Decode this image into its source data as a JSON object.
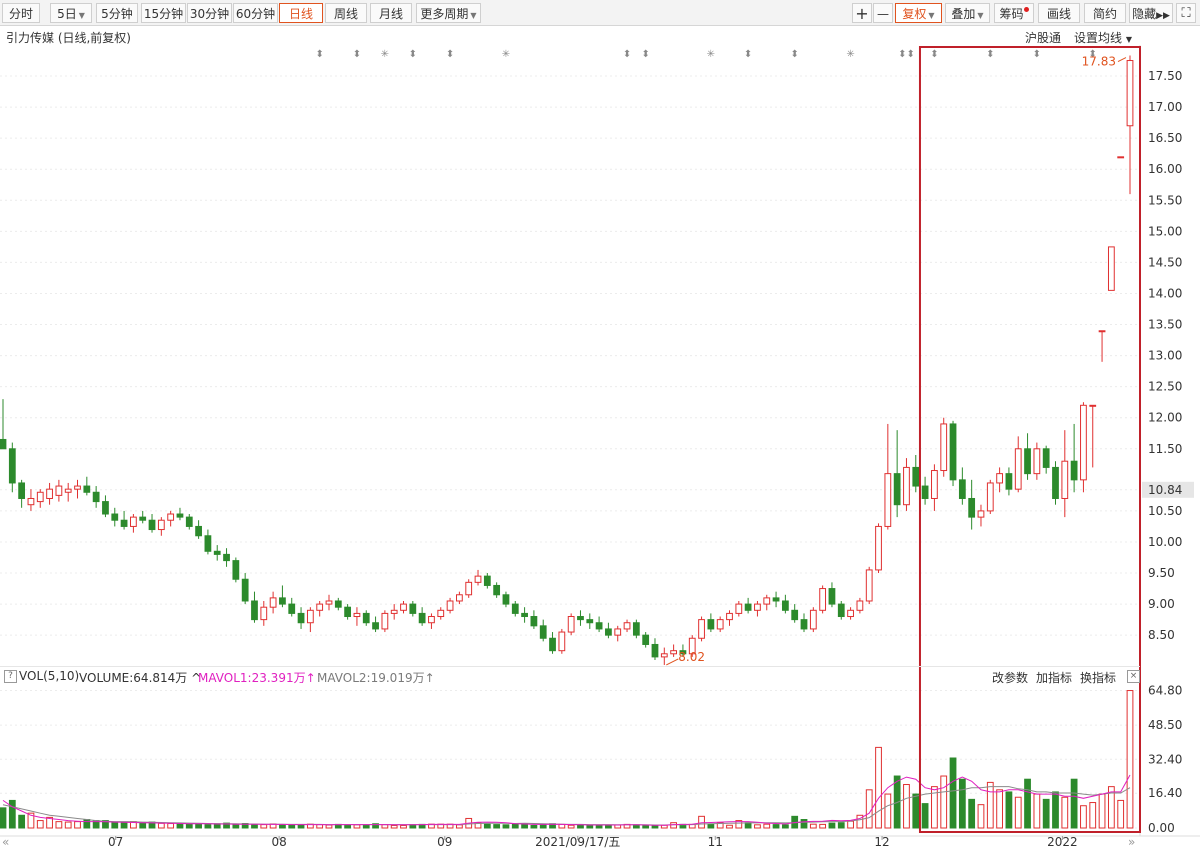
{
  "toolbar": {
    "left_buttons": [
      "分时",
      "5日",
      "5分钟",
      "15分钟",
      "30分钟",
      "60分钟",
      "日线",
      "周线",
      "月线",
      "更多周期"
    ],
    "active": "日线",
    "right_buttons": [
      "复权",
      "叠加",
      "筹码",
      "画线",
      "简约",
      "隐藏"
    ],
    "plus": "+",
    "minus": "—"
  },
  "chart_title": "引力传媒 (日线,前复权)",
  "links": {
    "hgt": "沪股通",
    "ma_settings": "设置均线"
  },
  "colors": {
    "up": "#e03030",
    "down": "#2c8a2c",
    "highlight": "#c0202a",
    "mavol1": "#e020c0",
    "mavol2": "#8a8a8a",
    "accent": "#e0531f"
  },
  "volume_header": {
    "name": "VOL(5,10)",
    "volume": "VOLUME:64.814万 ^",
    "mavol1": "MAVOL1:23.391万↑",
    "mavol2": "MAVOL2:19.019万↑",
    "actions": [
      "改参数",
      "加指标",
      "换指标"
    ],
    "help": "?",
    "close": "×"
  },
  "chart_data": [
    {
      "type": "candlestick",
      "title": "引力传媒 (日线,前复权)",
      "y_ticks": [
        8.5,
        9.0,
        9.5,
        10.0,
        10.5,
        10.84,
        11.5,
        12.0,
        12.5,
        13.0,
        13.5,
        14.0,
        14.5,
        15.0,
        15.5,
        16.0,
        16.5,
        17.0,
        17.5
      ],
      "current_price": 10.84,
      "ylim": [
        8.1,
        18.0
      ],
      "annotations": [
        {
          "label": "17.83",
          "kind": "high",
          "value": 17.83
        },
        {
          "label": "8.02",
          "kind": "low",
          "value": 8.02
        }
      ],
      "x_labels": [
        "07",
        "08",
        "09",
        "2021/09/17/五",
        "11",
        "12",
        "2022"
      ],
      "ohlc": [
        [
          11.65,
          12.3,
          11.55,
          11.5
        ],
        [
          11.5,
          11.6,
          10.8,
          10.95
        ],
        [
          10.95,
          11.0,
          10.55,
          10.7
        ],
        [
          10.6,
          10.85,
          10.5,
          10.7
        ],
        [
          10.65,
          10.85,
          10.55,
          10.8
        ],
        [
          10.7,
          10.95,
          10.6,
          10.85
        ],
        [
          10.75,
          11.0,
          10.65,
          10.9
        ],
        [
          10.8,
          10.95,
          10.65,
          10.85
        ],
        [
          10.85,
          11.0,
          10.7,
          10.9
        ],
        [
          10.9,
          11.05,
          10.75,
          10.8
        ],
        [
          10.8,
          10.9,
          10.55,
          10.65
        ],
        [
          10.65,
          10.75,
          10.4,
          10.45
        ],
        [
          10.45,
          10.55,
          10.25,
          10.35
        ],
        [
          10.35,
          10.5,
          10.2,
          10.25
        ],
        [
          10.25,
          10.45,
          10.15,
          10.4
        ],
        [
          10.4,
          10.5,
          10.3,
          10.35
        ],
        [
          10.35,
          10.45,
          10.15,
          10.2
        ],
        [
          10.2,
          10.4,
          10.1,
          10.35
        ],
        [
          10.35,
          10.5,
          10.25,
          10.45
        ],
        [
          10.45,
          10.55,
          10.35,
          10.4
        ],
        [
          10.4,
          10.45,
          10.2,
          10.25
        ],
        [
          10.25,
          10.35,
          10.05,
          10.1
        ],
        [
          10.1,
          10.2,
          9.8,
          9.85
        ],
        [
          9.85,
          9.95,
          9.7,
          9.8
        ],
        [
          9.8,
          9.9,
          9.6,
          9.7
        ],
        [
          9.7,
          9.75,
          9.35,
          9.4
        ],
        [
          9.4,
          9.5,
          9.0,
          9.05
        ],
        [
          9.05,
          9.2,
          8.7,
          8.75
        ],
        [
          8.75,
          9.05,
          8.65,
          8.95
        ],
        [
          8.95,
          9.2,
          8.85,
          9.1
        ],
        [
          9.1,
          9.3,
          8.95,
          9.0
        ],
        [
          9.0,
          9.1,
          8.8,
          8.85
        ],
        [
          8.85,
          8.95,
          8.6,
          8.7
        ],
        [
          8.7,
          8.95,
          8.55,
          8.9
        ],
        [
          8.9,
          9.05,
          8.8,
          9.0
        ],
        [
          9.0,
          9.15,
          8.9,
          9.05
        ],
        [
          9.05,
          9.1,
          8.9,
          8.95
        ],
        [
          8.95,
          9.0,
          8.75,
          8.8
        ],
        [
          8.8,
          8.95,
          8.65,
          8.85
        ],
        [
          8.85,
          8.9,
          8.65,
          8.7
        ],
        [
          8.7,
          8.8,
          8.55,
          8.6
        ],
        [
          8.6,
          8.9,
          8.55,
          8.85
        ],
        [
          8.85,
          9.0,
          8.75,
          8.9
        ],
        [
          8.9,
          9.05,
          8.85,
          9.0
        ],
        [
          9.0,
          9.05,
          8.8,
          8.85
        ],
        [
          8.85,
          8.95,
          8.65,
          8.7
        ],
        [
          8.7,
          8.85,
          8.6,
          8.8
        ],
        [
          8.8,
          8.95,
          8.75,
          8.9
        ],
        [
          8.9,
          9.1,
          8.85,
          9.05
        ],
        [
          9.05,
          9.2,
          9.0,
          9.15
        ],
        [
          9.15,
          9.4,
          9.1,
          9.35
        ],
        [
          9.35,
          9.55,
          9.3,
          9.45
        ],
        [
          9.45,
          9.5,
          9.25,
          9.3
        ],
        [
          9.3,
          9.35,
          9.1,
          9.15
        ],
        [
          9.15,
          9.2,
          8.95,
          9.0
        ],
        [
          9.0,
          9.05,
          8.8,
          8.85
        ],
        [
          8.85,
          8.95,
          8.7,
          8.8
        ],
        [
          8.8,
          8.9,
          8.6,
          8.65
        ],
        [
          8.65,
          8.75,
          8.4,
          8.45
        ],
        [
          8.45,
          8.55,
          8.2,
          8.25
        ],
        [
          8.25,
          8.6,
          8.2,
          8.55
        ],
        [
          8.55,
          8.85,
          8.5,
          8.8
        ],
        [
          8.8,
          8.9,
          8.65,
          8.75
        ],
        [
          8.75,
          8.85,
          8.6,
          8.7
        ],
        [
          8.7,
          8.8,
          8.55,
          8.6
        ],
        [
          8.6,
          8.7,
          8.45,
          8.5
        ],
        [
          8.5,
          8.65,
          8.4,
          8.6
        ],
        [
          8.6,
          8.75,
          8.55,
          8.7
        ],
        [
          8.7,
          8.75,
          8.45,
          8.5
        ],
        [
          8.5,
          8.55,
          8.3,
          8.35
        ],
        [
          8.35,
          8.45,
          8.1,
          8.15
        ],
        [
          8.15,
          8.3,
          8.02,
          8.2
        ],
        [
          8.2,
          8.35,
          8.15,
          8.25
        ],
        [
          8.25,
          8.35,
          8.15,
          8.2
        ],
        [
          8.2,
          8.5,
          8.15,
          8.45
        ],
        [
          8.45,
          8.8,
          8.4,
          8.75
        ],
        [
          8.75,
          8.85,
          8.55,
          8.6
        ],
        [
          8.6,
          8.8,
          8.55,
          8.75
        ],
        [
          8.75,
          8.9,
          8.65,
          8.85
        ],
        [
          8.85,
          9.05,
          8.8,
          9.0
        ],
        [
          9.0,
          9.1,
          8.85,
          8.9
        ],
        [
          8.9,
          9.05,
          8.8,
          9.0
        ],
        [
          9.0,
          9.15,
          8.9,
          9.1
        ],
        [
          9.1,
          9.2,
          8.95,
          9.05
        ],
        [
          9.05,
          9.15,
          8.85,
          8.9
        ],
        [
          8.9,
          9.0,
          8.7,
          8.75
        ],
        [
          8.75,
          8.85,
          8.55,
          8.6
        ],
        [
          8.6,
          8.95,
          8.55,
          8.9
        ],
        [
          8.9,
          9.3,
          8.85,
          9.25
        ],
        [
          9.25,
          9.35,
          8.95,
          9.0
        ],
        [
          9.0,
          9.05,
          8.75,
          8.8
        ],
        [
          8.8,
          8.95,
          8.75,
          8.9
        ],
        [
          8.9,
          9.1,
          8.85,
          9.05
        ],
        [
          9.05,
          9.6,
          9.0,
          9.55
        ],
        [
          9.55,
          10.3,
          9.5,
          10.25
        ],
        [
          10.25,
          11.9,
          10.2,
          11.1
        ],
        [
          11.1,
          11.8,
          10.4,
          10.6
        ],
        [
          10.6,
          11.35,
          10.5,
          11.2
        ],
        [
          11.2,
          11.4,
          10.8,
          10.9
        ],
        [
          10.9,
          11.05,
          10.6,
          10.7
        ],
        [
          10.7,
          11.25,
          10.5,
          11.15
        ],
        [
          11.15,
          12.0,
          11.05,
          11.9
        ],
        [
          11.9,
          11.95,
          10.9,
          11.0
        ],
        [
          11.0,
          11.2,
          10.6,
          10.7
        ],
        [
          10.7,
          11.0,
          10.2,
          10.4
        ],
        [
          10.4,
          10.6,
          10.25,
          10.5
        ],
        [
          10.5,
          11.0,
          10.45,
          10.95
        ],
        [
          10.95,
          11.2,
          10.8,
          11.1
        ],
        [
          11.1,
          11.2,
          10.75,
          10.85
        ],
        [
          10.85,
          11.7,
          10.8,
          11.5
        ],
        [
          11.5,
          11.75,
          11.0,
          11.1
        ],
        [
          11.1,
          11.6,
          11.0,
          11.5
        ],
        [
          11.5,
          11.55,
          11.1,
          11.2
        ],
        [
          11.2,
          11.3,
          10.6,
          10.7
        ],
        [
          10.7,
          11.8,
          10.4,
          11.3
        ],
        [
          11.3,
          11.9,
          10.8,
          11.0
        ],
        [
          11.0,
          12.25,
          10.8,
          12.2
        ],
        [
          12.2,
          12.2,
          11.2,
          12.2
        ],
        [
          13.4,
          13.4,
          12.9,
          13.4
        ],
        [
          14.05,
          14.75,
          14.05,
          14.75
        ],
        [
          16.2,
          16.2,
          16.2,
          16.2
        ],
        [
          16.7,
          17.83,
          15.6,
          17.75
        ]
      ]
    },
    {
      "type": "bar",
      "title": "VOL(5,10)",
      "unit": "万",
      "y_ticks": [
        0.0,
        16.4,
        32.4,
        48.5,
        64.8
      ],
      "ylim": [
        0,
        66
      ],
      "series_names": [
        "VOLUME",
        "MAVOL1",
        "MAVOL2"
      ],
      "values": [
        9.5,
        13,
        6,
        7,
        3.5,
        5,
        3,
        2.8,
        3,
        4,
        3.5,
        3.5,
        2.5,
        2.5,
        3,
        2.6,
        2.8,
        2.2,
        2.1,
        2.3,
        2,
        1.8,
        1.6,
        2,
        2.3,
        1.8,
        2.1,
        1.7,
        1.6,
        1.9,
        1.5,
        1.3,
        1.6,
        1.8,
        1.6,
        1.4,
        1.7,
        1.5,
        1.5,
        1.5,
        2,
        1.6,
        1.2,
        1.2,
        1.6,
        1.7,
        1.8,
        1.8,
        1.8,
        1.5,
        4.5,
        2.5,
        1.8,
        1.6,
        1.5,
        2.1,
        2,
        1.2,
        1.5,
        2,
        1.7,
        1.3,
        1.4,
        1.3,
        1.3,
        1.1,
        1.4,
        1.7,
        1.5,
        1.3,
        1.2,
        1.3,
        2.5,
        1.7,
        1.7,
        5.5,
        1.7,
        2.5,
        1.3,
        3.5,
        2.5,
        1.5,
        1.8,
        1.6,
        1.5,
        5.5,
        4,
        1.8,
        1.7,
        2.3,
        2.5,
        3.2,
        6,
        18,
        38,
        16,
        24.5,
        20.5,
        16,
        11.5,
        19.5,
        24.5,
        33,
        23,
        13.5,
        11,
        21.5,
        18,
        17,
        14.5,
        23,
        16,
        13.5,
        17,
        14.5,
        23,
        10.5,
        12,
        16,
        19.5,
        13,
        64.8
      ],
      "mavol1": [
        13,
        10,
        8,
        6,
        5,
        4.5,
        4,
        3.5,
        3.2,
        3,
        3,
        2.9,
        2.8,
        2.7,
        2.6,
        2.5,
        2.4,
        2.3,
        2.2,
        2.1,
        2,
        2,
        2,
        1.9,
        1.9,
        1.8,
        1.8,
        1.8,
        1.8,
        1.7,
        1.7,
        1.6,
        1.6,
        1.6,
        1.6,
        1.5,
        1.6,
        1.6,
        1.6,
        1.6,
        1.6,
        1.6,
        1.5,
        1.5,
        1.5,
        1.6,
        1.7,
        1.7,
        1.7,
        1.7,
        2.3,
        2.7,
        2.8,
        2.7,
        2.5,
        2,
        1.9,
        1.7,
        1.7,
        1.8,
        1.7,
        1.6,
        1.5,
        1.4,
        1.4,
        1.4,
        1.4,
        1.5,
        1.5,
        1.4,
        1.3,
        1.3,
        1.6,
        1.7,
        1.8,
        2.5,
        2.6,
        2.8,
        2.9,
        3,
        3,
        2.7,
        2.3,
        2.1,
        1.9,
        2.6,
        2.9,
        3.1,
        3.2,
        3.6,
        3.4,
        3.6,
        4.5,
        7,
        14,
        19,
        22,
        24,
        23,
        19,
        18,
        19,
        22,
        24,
        22,
        18,
        17,
        17,
        18,
        18,
        17,
        16,
        16,
        16,
        15,
        15,
        14,
        15,
        16,
        17,
        17,
        25
      ],
      "mavol2": [
        11,
        10,
        9,
        8,
        7,
        6,
        5.5,
        5,
        4.5,
        4,
        3.5,
        3.2,
        3,
        3,
        2.9,
        2.8,
        2.7,
        2.6,
        2.5,
        2.4,
        2.3,
        2.2,
        2.1,
        2,
        2,
        2,
        1.9,
        1.9,
        1.8,
        1.8,
        1.8,
        1.7,
        1.7,
        1.7,
        1.7,
        1.6,
        1.6,
        1.6,
        1.6,
        1.6,
        1.6,
        1.6,
        1.6,
        1.6,
        1.6,
        1.6,
        1.6,
        1.6,
        1.6,
        1.6,
        1.9,
        2.1,
        2.2,
        2.2,
        2.2,
        2.1,
        2.2,
        2.1,
        2,
        1.9,
        1.8,
        1.7,
        1.7,
        1.6,
        1.6,
        1.6,
        1.5,
        1.5,
        1.5,
        1.5,
        1.4,
        1.4,
        1.5,
        1.5,
        1.6,
        1.9,
        2,
        2.1,
        2.2,
        2.3,
        2.4,
        2.4,
        2.5,
        2.5,
        2.4,
        2.5,
        2.7,
        2.8,
        2.9,
        3,
        3,
        3.3,
        3.9,
        4.9,
        7.9,
        10.5,
        12,
        14,
        15,
        16,
        16.5,
        17,
        17.5,
        18,
        19,
        19,
        19.5,
        19.5,
        19.5,
        18.5,
        18,
        17,
        17,
        16.5,
        16.5,
        16.5,
        16,
        15.5,
        16,
        16.5,
        16.5,
        19
      ]
    }
  ],
  "event_markers": [
    {
      "label": "⬍"
    },
    {
      "label": "⬍"
    },
    {
      "label": "✳"
    },
    {
      "label": "⬍"
    },
    {
      "label": "⬍"
    },
    {
      "label": "✳"
    },
    {
      "label": "⬍"
    },
    {
      "label": "⬍"
    },
    {
      "label": "✳"
    },
    {
      "label": "⬍"
    },
    {
      "label": "⬍"
    },
    {
      "label": "✳"
    },
    {
      "label": "⬍⬍"
    },
    {
      "label": "⬍"
    },
    {
      "label": "⬍"
    },
    {
      "label": "⬍"
    },
    {
      "label": "⬍"
    }
  ]
}
